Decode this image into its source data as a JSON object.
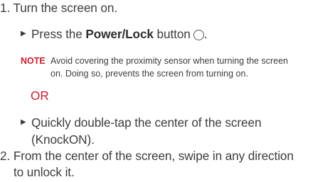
{
  "step1": {
    "number": "1.",
    "text": "Turn the screen on."
  },
  "bullet1": {
    "marker": "▶",
    "prefix": "Press the ",
    "bold": "Power/Lock",
    "suffix": " button",
    "icon": "power-button-circle-icon",
    "end": "."
  },
  "note": {
    "label": "NOTE",
    "line1": "Avoid covering the proximity sensor when turning the screen",
    "line2": "on. Doing so, prevents the screen from turning on."
  },
  "or_label": "OR",
  "bullet2": {
    "marker": "▶",
    "line1": "Quickly double-tap the center of the screen",
    "line2": "(KnockON)."
  },
  "step2": {
    "number": "2.",
    "line1": "From the center of the screen, swipe in any direction",
    "line2": "to unlock it."
  },
  "colors": {
    "text": "#3d3d3d",
    "accent_red": "#c8202f"
  }
}
